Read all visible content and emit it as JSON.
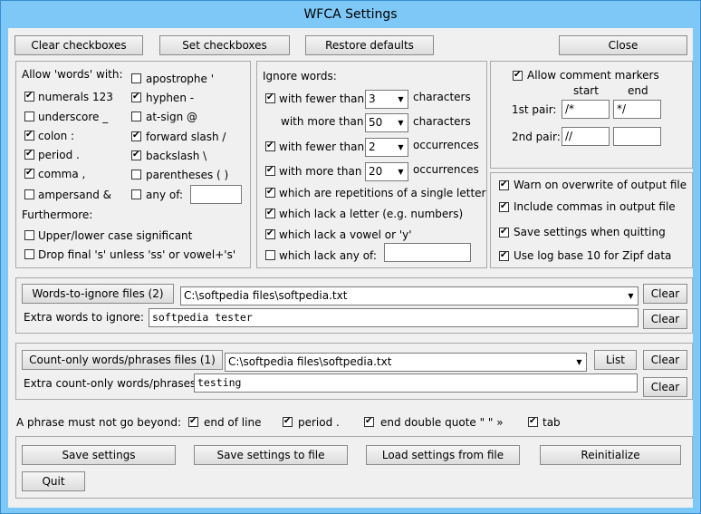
{
  "window": {
    "title": "WFCA Settings"
  },
  "top_buttons": {
    "clear": "Clear checkboxes",
    "set": "Set checkboxes",
    "restore": "Restore defaults",
    "close": "Close"
  },
  "allow": {
    "header": "Allow 'words' with:",
    "numerals": {
      "label": "numerals 123",
      "checked": true
    },
    "underscore": {
      "label": "underscore _",
      "checked": false
    },
    "colon": {
      "label": "colon :",
      "checked": true
    },
    "period": {
      "label": "period .",
      "checked": true
    },
    "comma": {
      "label": "comma ,",
      "checked": true
    },
    "ampersand": {
      "label": "ampersand &",
      "checked": false
    },
    "apostrophe": {
      "label": "apostrophe '",
      "checked": false
    },
    "hyphen": {
      "label": "hyphen -",
      "checked": true
    },
    "at_sign": {
      "label": "at-sign @",
      "checked": false
    },
    "forward_slash": {
      "label": "forward slash /",
      "checked": true
    },
    "backslash": {
      "label": "backslash \\",
      "checked": true
    },
    "parentheses": {
      "label": "parentheses ( )",
      "checked": false
    },
    "any_of": {
      "label": "any of:",
      "checked": false,
      "value": ""
    },
    "furthermore": "Furthermore:",
    "case": {
      "label": "Upper/lower case significant",
      "checked": false
    },
    "drop_s": {
      "label": "Drop final 's' unless 'ss' or vowel+'s'",
      "checked": false
    }
  },
  "ignore": {
    "header": "Ignore words:",
    "fewer_chars": {
      "label": "with fewer than",
      "checked": true,
      "value": "3",
      "unit": "characters"
    },
    "more_chars": {
      "label": "with more than",
      "value": "50",
      "unit": "characters"
    },
    "fewer_occ": {
      "label": "with fewer than",
      "checked": true,
      "value": "2",
      "unit": "occurrences"
    },
    "more_occ": {
      "label": "with more than",
      "checked": true,
      "value": "20",
      "unit": "occurrences"
    },
    "repetitions": {
      "label": "which are repetitions of a single letter",
      "checked": true
    },
    "lack_letter": {
      "label": "which lack a letter (e.g. numbers)",
      "checked": true
    },
    "lack_vowel": {
      "label": "which lack a vowel or 'y'",
      "checked": true
    },
    "lack_any": {
      "label": "which lack any of:",
      "checked": false,
      "value": ""
    }
  },
  "comments": {
    "allow": {
      "label": "Allow comment markers",
      "checked": true
    },
    "start": "start",
    "end": "end",
    "pair1": {
      "label": "1st pair:",
      "start": "/*",
      "end": "*/"
    },
    "pair2": {
      "label": "2nd pair:",
      "start": "//",
      "end": ""
    }
  },
  "options": {
    "warn": {
      "label": "Warn on overwrite of output file",
      "checked": true
    },
    "commas": {
      "label": "Include commas in output file",
      "checked": true
    },
    "save_quit": {
      "label": "Save settings when quitting",
      "checked": true
    },
    "log10": {
      "label": "Use log base 10 for Zipf data",
      "checked": true
    }
  },
  "ignore_files": {
    "button": "Words-to-ignore files (2)",
    "path": "C:\\softpedia files\\softpedia.txt",
    "clear1": "Clear",
    "extra_label": "Extra words to ignore:",
    "extra_value": "softpedia tester",
    "clear2": "Clear"
  },
  "count_files": {
    "button": "Count-only words/phrases files (1)",
    "path": "C:\\softpedia files\\softpedia.txt",
    "list": "List",
    "clear1": "Clear",
    "extra_label": "Extra count-only words/phrases:",
    "extra_value": "testing",
    "clear2": "Clear"
  },
  "phrase": {
    "label": "A phrase must not go beyond:",
    "end_line": {
      "label": "end of line",
      "checked": true
    },
    "period": {
      "label": "period .",
      "checked": true
    },
    "double_quote": {
      "label": "end double quote \" \" »",
      "checked": true
    },
    "tab": {
      "label": "tab",
      "checked": true
    }
  },
  "bottom_buttons": {
    "save": "Save settings",
    "save_file": "Save settings to file",
    "load_file": "Load settings from file",
    "reinit": "Reinitialize",
    "quit": "Quit"
  }
}
